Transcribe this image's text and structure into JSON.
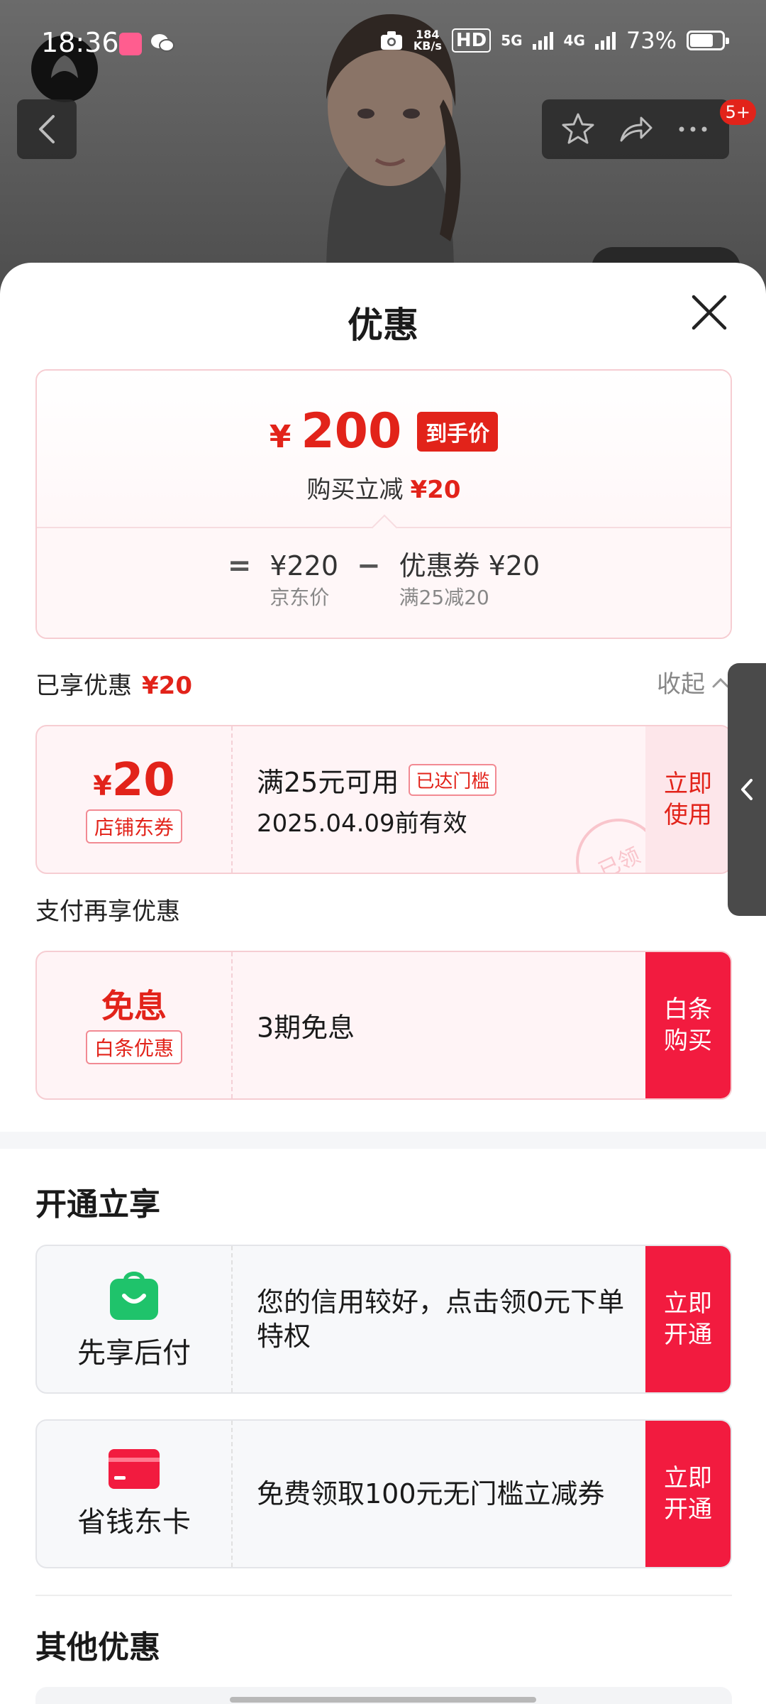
{
  "status": {
    "time": "18:36",
    "speed_top": "184",
    "speed_bottom": "KB/s",
    "hd": "HD",
    "net1": "5G",
    "net2": "4G",
    "battery": "73%",
    "battery_level": 0.73
  },
  "backdrop": {
    "cart_badge": "5+"
  },
  "sheet": {
    "title": "优惠"
  },
  "price": {
    "currency": "¥",
    "final": "200",
    "final_tag": "到手价",
    "instant_label": "购买立减",
    "instant_value": "¥20",
    "equals": "=",
    "minus": "−",
    "jd_price": "¥220",
    "jd_label": "京东价",
    "coupon_value": "优惠券 ¥20",
    "coupon_label": "满25减20"
  },
  "enjoyed": {
    "label": "已享优惠",
    "value": "¥20",
    "collapse": "收起"
  },
  "coupon1": {
    "currency": "¥",
    "amount": "20",
    "type": "店铺东券",
    "condition": "满25元可用",
    "reached": "已达门槛",
    "expiry": "2025.04.09前有效",
    "action": "立即使用",
    "stamp": "已领"
  },
  "pay": {
    "label": "支付再享优惠",
    "title": "免息",
    "type": "白条优惠",
    "desc": "3期免息",
    "action": "白条购买"
  },
  "open": {
    "heading": "开通立享",
    "items": [
      {
        "name": "先享后付",
        "desc": "您的信用较好，点击领0元下单特权",
        "action": "立即开通",
        "icon": "shopping-bag-icon",
        "color": "#1fc36b"
      },
      {
        "name": "省钱东卡",
        "desc": "免费领取100元无门槛立减券",
        "action": "立即开通",
        "icon": "card-icon",
        "color": "#f21b3f"
      }
    ]
  },
  "other": {
    "heading": "其他优惠"
  },
  "colors": {
    "accent": "#e2231a",
    "action_red": "#f21b3f"
  }
}
